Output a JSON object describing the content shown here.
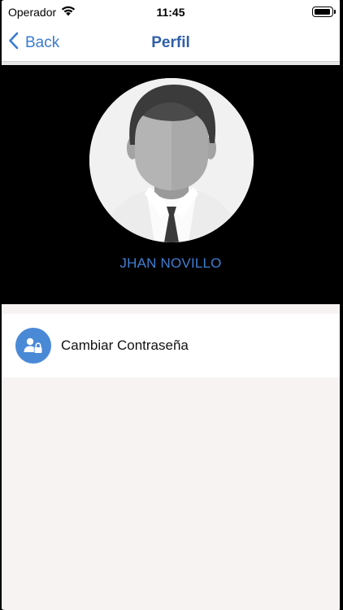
{
  "status_bar": {
    "carrier": "Operador",
    "time": "11:45"
  },
  "nav": {
    "back_label": "Back",
    "title": "Perfil"
  },
  "profile": {
    "name": "JHAN NOVILLO"
  },
  "options": [
    {
      "label": "Cambiar Contraseña",
      "icon": "user-lock-icon"
    }
  ],
  "colors": {
    "accent": "#3a7bd0",
    "title": "#2f5fa8",
    "icon_bg": "#4a89d6",
    "header_bg": "#000000",
    "page_bg": "#f6f3f2"
  }
}
